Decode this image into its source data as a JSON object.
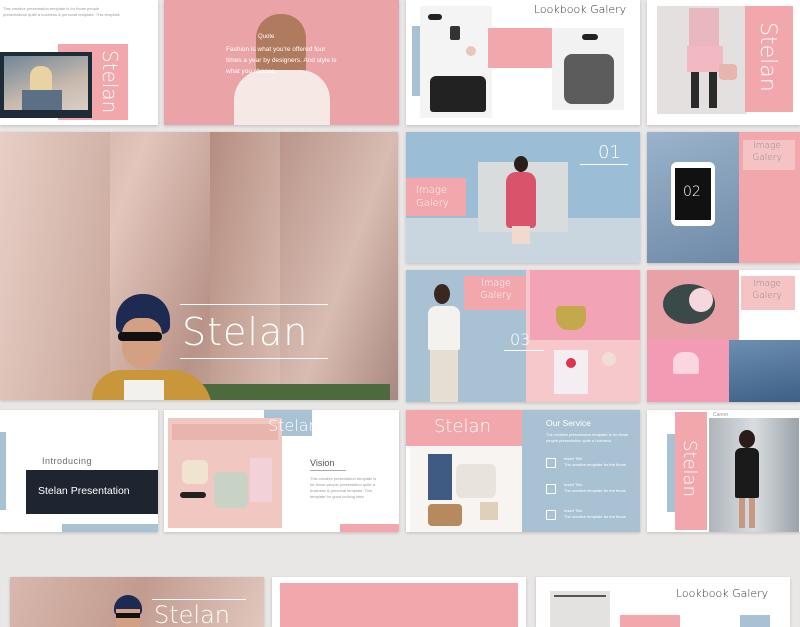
{
  "slides": {
    "s1": {
      "body": "This creative presentation template is for those people\npresentations quite a business & personal template. This template"
    },
    "s2": {
      "label": "Quote",
      "quote": "Fashion is what you're offered four times a year by designers. And style is what you choose."
    },
    "s3": {
      "title": "Lookbook Galery"
    },
    "s4": {
      "title": "Stelan"
    },
    "hero": {
      "title": "Stelan"
    },
    "s6": {
      "title": "Image Galery",
      "number": "01"
    },
    "s7": {
      "title": "Image Galery",
      "number": "02"
    },
    "s8": {
      "title": "Image Galery",
      "number": "03"
    },
    "s9": {
      "title": "Image Galery"
    },
    "s10": {
      "intro": "Introducing",
      "name": "Stelan Presentation"
    },
    "s11": {
      "title": "Stelan",
      "section": "Vision",
      "body": "This creative presentation template is for those people presentation quite a business & personal template. This template for good looking idea"
    },
    "s12": {
      "title": "Stelan",
      "heading": "Our Service",
      "intro": "The creative presentation template is for those people presentation quite a business.",
      "items": [
        {
          "title": "Insert Title",
          "text": "The creative template for the those"
        },
        {
          "title": "Insert Title",
          "text": "The creative template for the those"
        },
        {
          "title": "Insert Title",
          "text": "The creative template for the those"
        }
      ]
    },
    "s13": {
      "title": "Stelan",
      "label": "Career"
    },
    "b1": {
      "title": "Stelan"
    },
    "b3": {
      "title": "Lookbook Galery"
    }
  },
  "colors": {
    "pink": "#f1a7ab",
    "blue": "#a9c2d3",
    "dark": "#1f2530",
    "background": "#e9e6e6"
  },
  "icons": [
    "tshirt-icon",
    "camera-icon",
    "monitor-icon",
    "menu-icon"
  ]
}
